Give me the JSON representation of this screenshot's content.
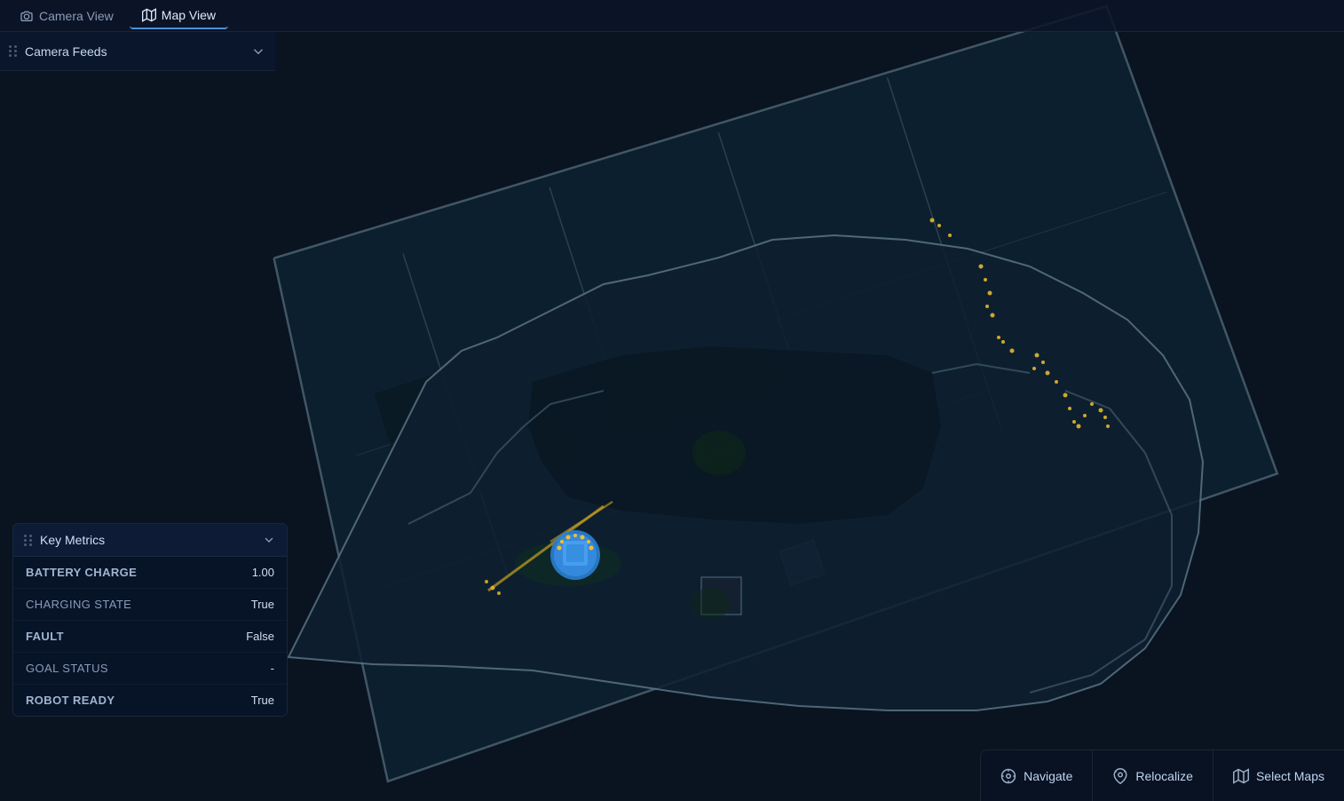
{
  "nav": {
    "tabs": [
      {
        "id": "camera-view",
        "label": "Camera View",
        "active": false
      },
      {
        "id": "map-view",
        "label": "Map View",
        "active": true
      }
    ]
  },
  "camera_feeds": {
    "label": "Camera Feeds",
    "expanded": false
  },
  "key_metrics": {
    "title": "Key Metrics",
    "metrics": [
      {
        "key": "BATTERY CHARGE",
        "value": "1.00",
        "uppercase": true
      },
      {
        "key": "Charging State",
        "value": "True",
        "uppercase": false
      },
      {
        "key": "FAULT",
        "value": "False",
        "uppercase": true
      },
      {
        "key": "Goal Status",
        "value": "-",
        "uppercase": false
      },
      {
        "key": "ROBOT READY",
        "value": "True",
        "uppercase": true
      }
    ]
  },
  "toolbar": {
    "buttons": [
      {
        "id": "navigate",
        "label": "Navigate"
      },
      {
        "id": "relocalize",
        "label": "Relocalize"
      },
      {
        "id": "select-maps",
        "label": "Select Maps"
      }
    ]
  },
  "colors": {
    "accent_blue": "#4a90d9",
    "robot_blue": "#4da6e8",
    "map_wall": "#6a7e8a",
    "map_floor": "#0d2030",
    "lidar_yellow": "#f5c842",
    "background": "#091420"
  }
}
